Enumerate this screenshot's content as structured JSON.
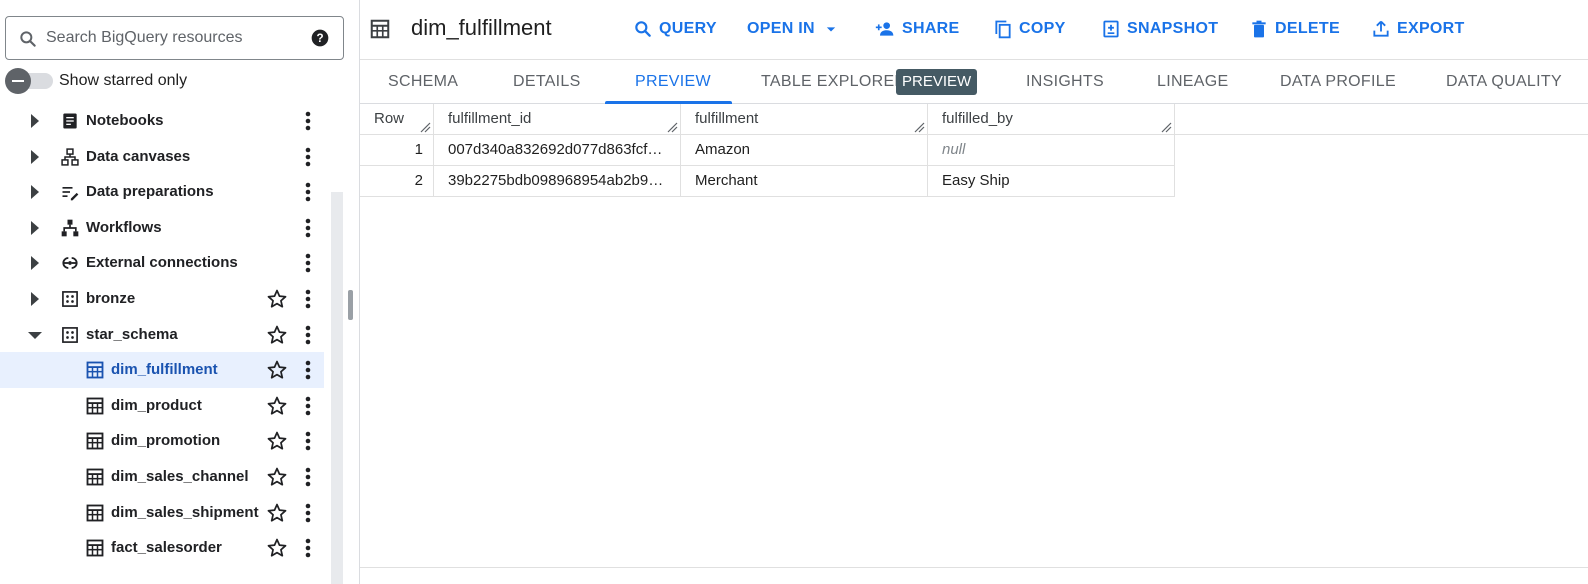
{
  "search": {
    "placeholder": "Search BigQuery resources"
  },
  "starred": {
    "label": "Show starred only",
    "enabled": false
  },
  "tree": {
    "items": [
      {
        "label": "Notebooks",
        "icon": "notebook-icon",
        "expandable": true,
        "starrable": false
      },
      {
        "label": "Data canvases",
        "icon": "data-canvas-icon",
        "expandable": true,
        "starrable": false
      },
      {
        "label": "Data preparations",
        "icon": "data-preparation-icon",
        "expandable": true,
        "starrable": false
      },
      {
        "label": "Workflows",
        "icon": "workflow-icon",
        "expandable": true,
        "starrable": false
      },
      {
        "label": "External connections",
        "icon": "external-connection-icon",
        "expandable": true,
        "starrable": false
      },
      {
        "label": "bronze",
        "icon": "dataset-icon",
        "expandable": true,
        "starrable": true
      },
      {
        "label": "star_schema",
        "icon": "dataset-icon",
        "expandable": true,
        "expanded": true,
        "starrable": true
      },
      {
        "label": "dim_fulfillment",
        "icon": "table-icon",
        "child": true,
        "selected": true,
        "starrable": true
      },
      {
        "label": "dim_product",
        "icon": "table-icon",
        "child": true,
        "starrable": true
      },
      {
        "label": "dim_promotion",
        "icon": "table-icon",
        "child": true,
        "starrable": true
      },
      {
        "label": "dim_sales_channel",
        "icon": "table-icon",
        "child": true,
        "starrable": true
      },
      {
        "label": "dim_sales_shipment",
        "icon": "table-icon",
        "child": true,
        "starrable": true
      },
      {
        "label": "fact_salesorder",
        "icon": "table-icon",
        "child": true,
        "starrable": true
      }
    ]
  },
  "header": {
    "title": "dim_fulfillment",
    "actions": [
      {
        "label": "QUERY",
        "icon": "search-icon"
      },
      {
        "label": "OPEN IN",
        "icon": "dropdown-icon"
      },
      {
        "label": "SHARE",
        "icon": "share-person-icon"
      },
      {
        "label": "COPY",
        "icon": "copy-icon"
      },
      {
        "label": "SNAPSHOT",
        "icon": "snapshot-icon"
      },
      {
        "label": "DELETE",
        "icon": "trash-icon"
      },
      {
        "label": "EXPORT",
        "icon": "export-icon"
      }
    ]
  },
  "tabs": {
    "items": [
      "SCHEMA",
      "DETAILS",
      "PREVIEW",
      "TABLE EXPLORER",
      "INSIGHTS",
      "LINEAGE",
      "DATA PROFILE",
      "DATA QUALITY"
    ],
    "active": "PREVIEW",
    "badge": "PREVIEW"
  },
  "preview": {
    "columns": [
      "Row",
      "fulfillment_id",
      "fulfillment",
      "fulfilled_by"
    ],
    "rows": [
      {
        "row": "1",
        "fulfillment_id": "007d340a832692d077d863fcf…",
        "fulfillment": "Amazon",
        "fulfilled_by": "null",
        "fulfilled_by_is_null": true
      },
      {
        "row": "2",
        "fulfillment_id": "39b2275bdb098968954ab2b9…",
        "fulfillment": "Merchant",
        "fulfilled_by": "Easy Ship",
        "fulfilled_by_is_null": false
      }
    ]
  },
  "colors": {
    "accent": "#1a73e8",
    "selected_bg": "#e8f0fe",
    "badge_bg": "#455a64"
  }
}
